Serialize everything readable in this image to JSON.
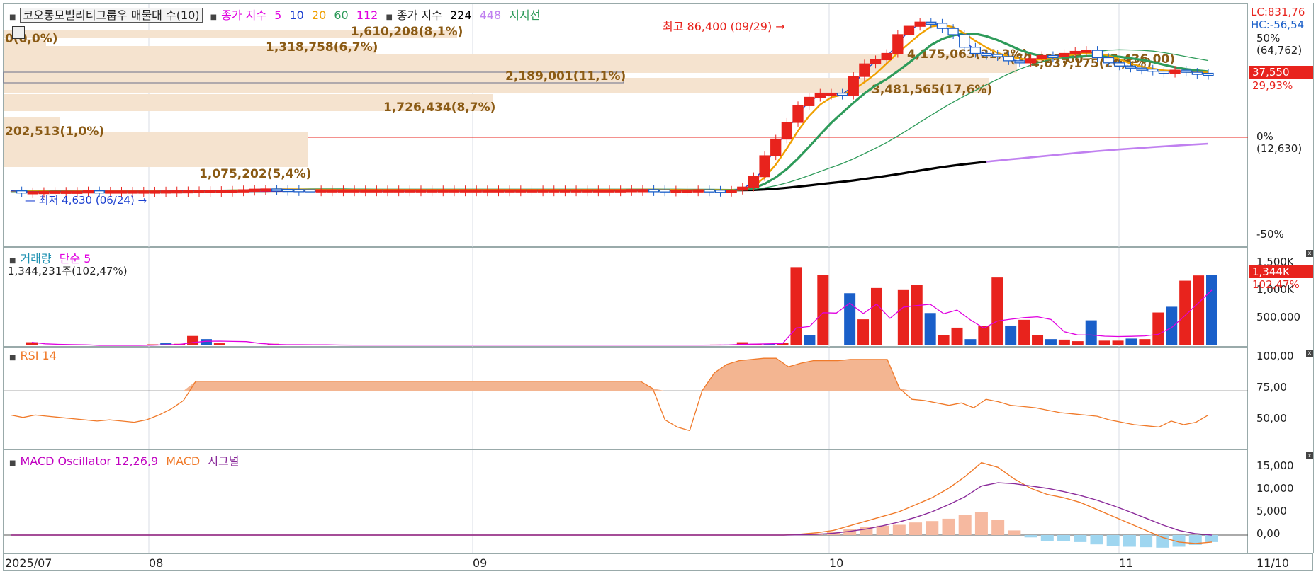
{
  "price": {
    "title": "코오롱모빌리티그룹우 매물대 수(10)",
    "ma_label": "종가 지수",
    "ma_periods": [
      "5",
      "10",
      "20",
      "60",
      "112"
    ],
    "ma2_label": "종가 지수",
    "ma2_periods": [
      "224",
      "448"
    ],
    "support_label": "지지선",
    "lc": "LC:831,76",
    "hc": "HC:-56,54",
    "high_note": "최고 86,400 (09/29)",
    "low_note": "최저 4,630 (06/24)",
    "scale_labels": [
      "50%",
      "(64,762)",
      "0%",
      "(12,630)",
      "-50%"
    ],
    "current_price": "37,550",
    "current_pct": "29,93%",
    "range_note": "(52,327.00 ~ 45,436.00)",
    "volume_profile": [
      {
        "label": "1,610,208(8,1%)"
      },
      {
        "label": "0(0,0%)"
      },
      {
        "label": "1,318,758(6,7%)"
      },
      {
        "label": "4,175,063(21,3%)"
      },
      {
        "label": "4,037,175(20,5%)"
      },
      {
        "label": "2,189,001(11,1%)"
      },
      {
        "label": "3,481,565(17,6%)"
      },
      {
        "label": "1,726,434(8,7%)"
      },
      {
        "label": "202,513(1,0%)"
      },
      {
        "label": "1,075,202(5,4%)"
      }
    ]
  },
  "volume": {
    "title": "거래량",
    "ma_label": "단순 5",
    "value_text": "1,344,231주(102,47%)",
    "scale_labels": [
      "1,500K",
      "1,000K",
      "500,000"
    ],
    "tag_value": "1,344K",
    "tag_pct": "102,47%"
  },
  "rsi": {
    "title": "RSI 14",
    "scale_labels": [
      "100,00",
      "75,00",
      "50,00"
    ]
  },
  "macd": {
    "title": "MACD Oscillator 12,26,9",
    "macd_label": "MACD",
    "signal_label": "시그널",
    "scale_labels": [
      "15,000",
      "10,000",
      "5,000",
      "0,00"
    ]
  },
  "xaxis": {
    "labels": [
      "2025/07",
      "08",
      "09",
      "10",
      "11",
      "11/10"
    ]
  },
  "colors": {
    "up": "#e8231d",
    "down": "#1a5fc9",
    "ma5": "#e000e0",
    "ma10": "#1a3fd0",
    "ma20": "#f0a000",
    "ma60": "#2e9b5a",
    "ma112": "#e000e0",
    "ma224": "#000000",
    "ma448": "#c080f0",
    "profile": "#f5e3cf",
    "profile_text": "#8a5a14",
    "rsi": "#f07a2a",
    "rsi_fill": "#f3b591",
    "macd_line": "#f07a2a",
    "signal_line": "#8a2a9a",
    "osc_pos": "#f6b9a0",
    "osc_neg": "#9fd6f0"
  },
  "chart_data": [
    {
      "type": "candlestick",
      "title": "코오롱모빌리티그룹우 매물대 수(10)",
      "note": "approximate daily closes, 2025/06 - 2025/11",
      "x_ticks": [
        "2025/07",
        "08",
        "09",
        "10",
        "11"
      ],
      "closes": [
        5200,
        4800,
        4800,
        4900,
        5000,
        5000,
        5000,
        5200,
        5100,
        5100,
        5100,
        5100,
        5100,
        5100,
        5150,
        5200,
        5250,
        5300,
        5350,
        5400,
        5500,
        5700,
        6000,
        6100,
        5900,
        5800,
        5750,
        5700,
        5700,
        5700,
        5700,
        5700,
        5700,
        5700,
        5700,
        5700,
        5700,
        5700,
        5700,
        5700,
        5700,
        5700,
        5700,
        5700,
        5700,
        5700,
        5700,
        5700,
        5700,
        5700,
        5700,
        5700,
        5700,
        5700,
        5700,
        5700,
        5800,
        5800,
        5700,
        5500,
        5600,
        5600,
        5700,
        5500,
        5300,
        5500,
        7000,
        12000,
        22000,
        30000,
        38000,
        46000,
        50000,
        52000,
        52000,
        51000,
        60000,
        66000,
        68000,
        71000,
        80000,
        84000,
        86000,
        85500,
        83000,
        80000,
        74000,
        71000,
        70500,
        69500,
        67500,
        66500,
        68500,
        70000,
        69500,
        71000,
        72000,
        72500,
        69000,
        66500,
        65000,
        64000,
        63500,
        62500,
        61500,
        63000,
        62000,
        61500,
        61000
      ],
      "ylim": [
        0,
        100000
      ]
    },
    {
      "type": "bar",
      "title": "거래량",
      "note": "daily volume (selected visible bars)",
      "values": [
        60000,
        0,
        0,
        0,
        0,
        0,
        0,
        0,
        0,
        20000,
        40000,
        30000,
        180000,
        120000,
        40000,
        10000,
        10000,
        10000,
        30000,
        10000,
        8000,
        5000,
        5000,
        5000,
        5000,
        5000,
        5000,
        5000,
        5000,
        5000,
        5000,
        5000,
        5000,
        5000,
        5000,
        5000,
        5000,
        5000,
        5000,
        5000,
        5000,
        5000,
        5000,
        5000,
        5000,
        5000,
        5000,
        5000,
        5000,
        5000,
        5000,
        15000,
        15000,
        60000,
        30000,
        30000,
        50000,
        1500000,
        200000,
        1350000,
        0,
        1000000,
        500000,
        1100000,
        0,
        1060000,
        1160000,
        620000,
        200000,
        340000,
        120000,
        370000,
        1300000,
        380000,
        490000,
        200000,
        120000,
        110000,
        80000,
        480000,
        90000,
        90000,
        130000,
        120000,
        630000,
        740000,
        1240000,
        1340000,
        1344231
      ],
      "ylim": [
        0,
        1600000
      ]
    },
    {
      "type": "line",
      "title": "RSI 14",
      "values": [
        50,
        48,
        50,
        49,
        48,
        47,
        46,
        45,
        46,
        45,
        44,
        46,
        50,
        55,
        62,
        78,
        78,
        78,
        78,
        78,
        78,
        78,
        78,
        78,
        78,
        78,
        78,
        78,
        78,
        78,
        78,
        78,
        78,
        78,
        78,
        78,
        78,
        78,
        78,
        78,
        78,
        78,
        78,
        78,
        78,
        78,
        78,
        78,
        78,
        78,
        78,
        78,
        72,
        46,
        40,
        37,
        70,
        85,
        92,
        95,
        96,
        97,
        97,
        90,
        93,
        95,
        95,
        95,
        96,
        96,
        96,
        96,
        72,
        63,
        62,
        60,
        58,
        60,
        56,
        63,
        61,
        58,
        57,
        56,
        54,
        52,
        51,
        50,
        49,
        46,
        44,
        42,
        41,
        40,
        45,
        42,
        44,
        50
      ],
      "ylim": [
        25,
        100
      ],
      "threshold": 70
    },
    {
      "type": "line",
      "title": "MACD Oscillator 12,26,9",
      "series": [
        {
          "name": "MACD",
          "values": [
            0,
            0,
            0,
            0,
            0,
            0,
            0,
            0,
            0,
            0,
            0,
            0,
            0,
            0,
            0,
            0,
            0,
            0,
            0,
            0,
            0,
            0,
            0,
            0,
            0,
            0,
            0,
            0,
            0,
            0,
            0,
            0,
            0,
            0,
            0,
            0,
            0,
            0,
            0,
            0,
            0,
            0,
            0,
            0,
            0,
            0,
            0,
            0,
            200,
            500,
            1000,
            2000,
            3000,
            4000,
            5000,
            6500,
            8000,
            10000,
            12500,
            15500,
            14500,
            12000,
            10000,
            8700,
            8000,
            7000,
            5500,
            4000,
            2500,
            1000,
            -500,
            -1500,
            -1800,
            -1500
          ]
        },
        {
          "name": "시그널",
          "values": [
            0,
            0,
            0,
            0,
            0,
            0,
            0,
            0,
            0,
            0,
            0,
            0,
            0,
            0,
            0,
            0,
            0,
            0,
            0,
            0,
            0,
            0,
            0,
            0,
            0,
            0,
            0,
            0,
            0,
            0,
            0,
            0,
            0,
            0,
            0,
            0,
            0,
            0,
            0,
            0,
            0,
            0,
            0,
            0,
            0,
            0,
            0,
            0,
            50,
            150,
            400,
            800,
            1300,
            2000,
            2800,
            3800,
            5000,
            6500,
            8200,
            10500,
            11200,
            11000,
            10500,
            10000,
            9300,
            8500,
            7500,
            6300,
            5000,
            3600,
            2200,
            1000,
            300,
            0
          ]
        }
      ],
      "ylim": [
        -4000,
        17000
      ]
    }
  ]
}
